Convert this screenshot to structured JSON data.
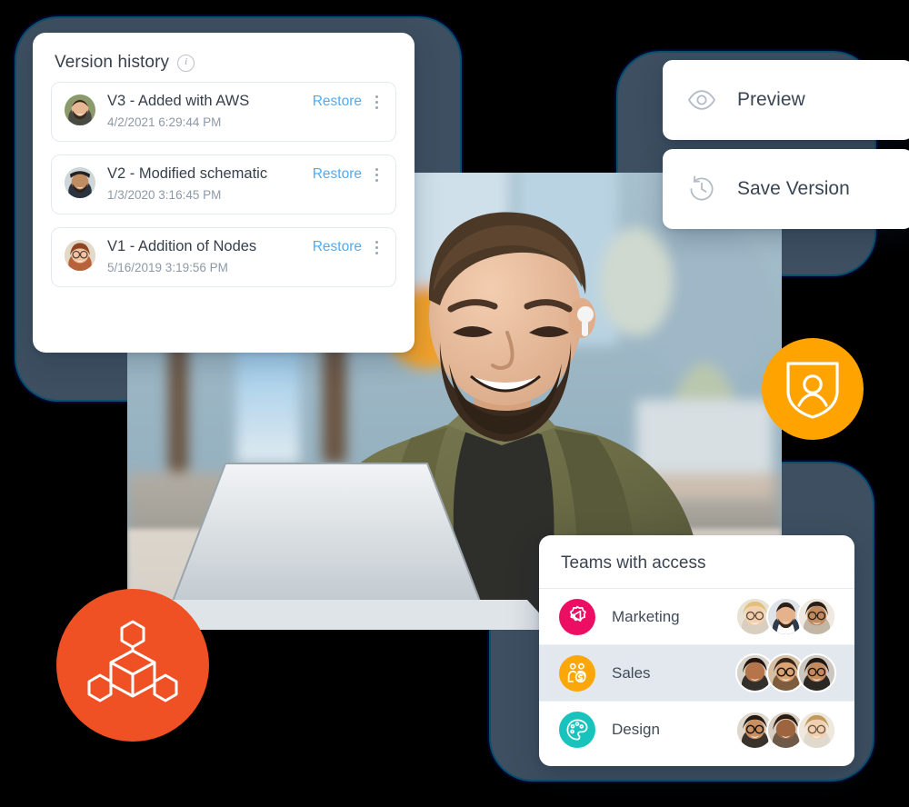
{
  "version_panel": {
    "title": "Version history",
    "info_icon": "info-icon",
    "items": [
      {
        "title": "V3 - Added with AWS",
        "date": "4/2/2021 6:29:44 PM",
        "restore_label": "Restore",
        "menu_icon": "kebab-menu-icon",
        "avatar": "avatar-man-beard"
      },
      {
        "title": "V2 - Modified schematic",
        "date": "1/3/2020 3:16:45 PM",
        "restore_label": "Restore",
        "menu_icon": "kebab-menu-icon",
        "avatar": "avatar-man-hat"
      },
      {
        "title": "V1 - Addition of Nodes",
        "date": "5/16/2019 3:19:56 PM",
        "restore_label": "Restore",
        "menu_icon": "kebab-menu-icon",
        "avatar": "avatar-woman-glasses"
      }
    ]
  },
  "actions": [
    {
      "label": "Preview",
      "icon": "eye-icon"
    },
    {
      "label": "Save Version",
      "icon": "history-clock-icon"
    }
  ],
  "badges": [
    {
      "name": "shield-user-icon",
      "color": "#FFA300"
    },
    {
      "name": "node-network-icon",
      "color": "#EF5125"
    }
  ],
  "teams_panel": {
    "title": "Teams with access",
    "rows": [
      {
        "name": "Marketing",
        "icon": "megaphone-gear-icon",
        "icon_color": "#EC0E62",
        "selected": false,
        "member_count": 3
      },
      {
        "name": "Sales",
        "icon": "people-dollar-icon",
        "icon_color": "#FBA70A",
        "selected": true,
        "member_count": 3
      },
      {
        "name": "Design",
        "icon": "palette-icon",
        "icon_color": "#18C3BE",
        "selected": false,
        "member_count": 3
      }
    ]
  },
  "hero_photo": {
    "alt": "Smiling man with beard and earbuds working on a silver laptop in a bright room"
  },
  "colors": {
    "slate_card": "#3D4F60",
    "restore_link": "#51ABF2",
    "title_text": "#37404C",
    "muted_text": "#8D99A6",
    "row_selected": "#E3E8EF",
    "teal_edge": "#0F8C96"
  }
}
